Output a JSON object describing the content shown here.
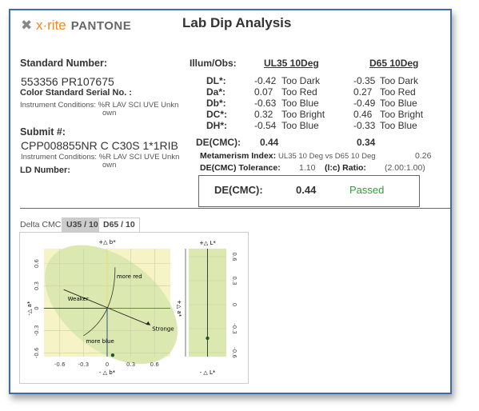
{
  "header": {
    "logo_brand": "x·rite",
    "logo_partner": "PANTONE",
    "title": "Lab Dip Analysis"
  },
  "standard": {
    "label": "Standard Number:",
    "value": "553356 PR107675",
    "serial_label": "Color Standard Serial No. :",
    "conditions": "Instrument Conditions: %R LAV SCI UVE Unkn",
    "conditions_wrap": "own"
  },
  "submit": {
    "label": "Submit #:",
    "value": "CPP008855NR C C30S 1*1RIB",
    "conditions": "Instrument Conditions: %R LAV SCI UVE Unkn",
    "conditions_wrap": "own",
    "ld_label": "LD Number:"
  },
  "results": {
    "illum_label": "Illum/Obs:",
    "col1": "UL35 10Deg",
    "col2": "D65 10Deg",
    "rows": [
      {
        "label": "DL*:",
        "v1": "-0.42",
        "t1": "Too Dark",
        "v2": "-0.35",
        "t2": "Too Dark"
      },
      {
        "label": "Da*:",
        "v1": "0.07",
        "t1": "Too Red",
        "v2": "0.27",
        "t2": "Too Red"
      },
      {
        "label": "Db*:",
        "v1": "-0.63",
        "t1": "Too Blue",
        "v2": "-0.49",
        "t2": "Too Blue"
      },
      {
        "label": "DC*:",
        "v1": "0.32",
        "t1": "Too Bright",
        "v2": "0.46",
        "t2": "Too Bright"
      },
      {
        "label": "DH*:",
        "v1": "-0.54",
        "t1": "Too Blue",
        "v2": "-0.33",
        "t2": "Too Blue"
      }
    ],
    "de_label": "DE(CMC):",
    "de1": "0.44",
    "de2": "0.34",
    "meta_label": "Metamerism Index:",
    "meta_text": "UL35 10 Deg vs D65 10 Deg",
    "meta_value": "0.26",
    "tol_label": "DE(CMC) Tolerance:",
    "tol_value": "1.10",
    "ratio_label": "(l:c) Ratio:",
    "ratio_value": "(2.00:1.00)"
  },
  "verdict": {
    "label": "DE(CMC):",
    "value": "0.44",
    "status": "Passed",
    "status_color": "#2e9e3a"
  },
  "chart_tabs": {
    "label": "Delta CMC",
    "tabs": [
      "U35 / 10",
      "D65 / 10"
    ],
    "active": 0
  },
  "plot": {
    "top_label": "+△ b*",
    "bottom_label": "- △ b*",
    "left_label": "-△ a*",
    "right_label": "+△ a*",
    "ticks": [
      "-0.6",
      "-0.3",
      "0",
      "0.3",
      "0.6"
    ],
    "annotations": {
      "red": "more red",
      "blue": "more blue",
      "weaker": "Weaker",
      "stronger": "Stronge"
    },
    "lightness_top": "+△ L*",
    "lightness_bottom": "- △ L*"
  },
  "chart_data": [
    {
      "type": "scatter",
      "x": [
        0.07
      ],
      "y": [
        -0.63
      ],
      "xlim": [
        -0.8,
        0.8
      ],
      "ylim": [
        -0.65,
        0.8
      ],
      "ticks": [
        -0.6,
        -0.3,
        0,
        0.3,
        0.6
      ]
    },
    {
      "type": "scatter",
      "y": [
        -0.42
      ],
      "ylim": [
        -0.65,
        0.7
      ],
      "ticks": [
        -0.6,
        -0.3,
        0,
        0.3,
        0.6
      ]
    }
  ]
}
